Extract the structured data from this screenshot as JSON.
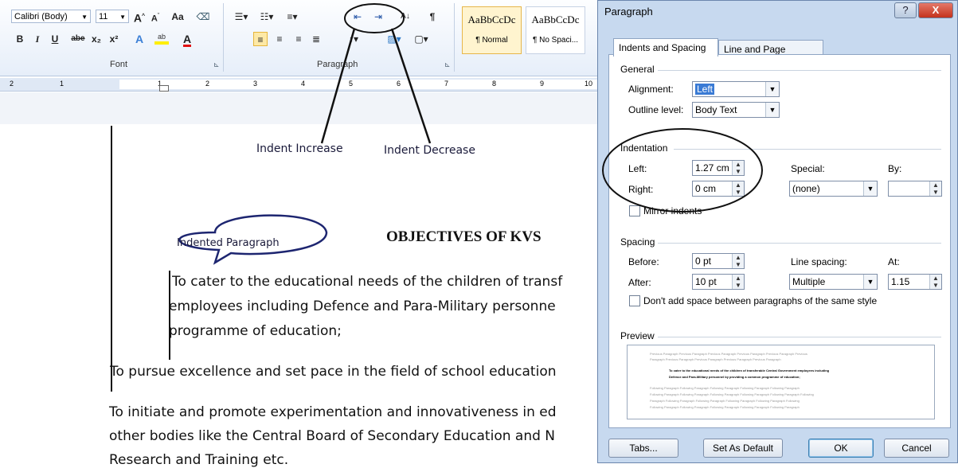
{
  "ribbon": {
    "font_name": "Calibri (Body)",
    "font_size": "11",
    "grow_font": "A",
    "shrink_font": "A",
    "change_case": "Aa",
    "bold": "B",
    "italic": "I",
    "underline": "U",
    "strike": "abe",
    "subscript": "x₂",
    "superscript": "x²",
    "font_color": "A",
    "font_group": "Font",
    "paragraph_group": "Paragraph",
    "styles": [
      {
        "preview": "AaBbCcDc",
        "name": "¶ Normal"
      },
      {
        "preview": "AaBbCcDc",
        "name": "¶ No Spaci..."
      }
    ]
  },
  "ruler": {
    "ticks": [
      "2",
      "1",
      "1",
      "2",
      "3",
      "4",
      "5",
      "6",
      "7",
      "8",
      "9",
      "10"
    ]
  },
  "annotations": {
    "indent_increase": "Indent Increase",
    "indent_decrease": "Indent Decrease",
    "bubble": "Indented Paragraph"
  },
  "document": {
    "heading": "OBJECTIVES OF KVS",
    "indented_lines": [
      "To cater to the educational needs of the children of transf",
      "employees including Defence  and Para-Military personne",
      "programme of education;"
    ],
    "para2": "To pursue excellence and set pace in the field of school education",
    "para3_lines": [
      "To initiate and promote experimentation and innovativeness in ed",
      "other bodies like the Central Board of Secondary Education and N",
      "Research and Training etc."
    ]
  },
  "dialog": {
    "title": "Paragraph",
    "help": "?",
    "close": "X",
    "tabs": [
      "Indents and Spacing",
      "Line and Page Breaks"
    ],
    "general": {
      "section": "General",
      "alignment_label": "Alignment:",
      "alignment_value": "Left",
      "outline_label": "Outline level:",
      "outline_value": "Body Text"
    },
    "indentation": {
      "section": "Indentation",
      "left_label": "Left:",
      "left_value": "1.27 cm",
      "right_label": "Right:",
      "right_value": "0 cm",
      "special_label": "Special:",
      "special_value": "(none)",
      "by_label": "By:",
      "by_value": "",
      "mirror_label": "Mirror indents"
    },
    "spacing": {
      "section": "Spacing",
      "before_label": "Before:",
      "before_value": "0 pt",
      "after_label": "After:",
      "after_value": "10 pt",
      "line_spacing_label": "Line spacing:",
      "line_spacing_value": "Multiple",
      "at_label": "At:",
      "at_value": "1.15",
      "dont_add_label": "Don't add space between paragraphs of the same style"
    },
    "preview": {
      "section": "Preview",
      "prev_lines": [
        "Previous Paragraph Previous Paragraph Previous Paragraph Previous Paragraph Previous Paragraph Previous",
        "Paragraph Previous Paragraph Previous Paragraph Previous Paragraph Previous Paragraph"
      ],
      "sample_lines": [
        "To cater to the educational needs of the children of transferable Central Government employees including",
        "Defence and Para-Military personnel by providing a common programme of education;"
      ],
      "follow_lines": [
        "Following Paragraph Following Paragraph Following Paragraph Following Paragraph Following Paragraph",
        "Following Paragraph Following Paragraph Following Paragraph Following Paragraph Following Paragraph Following",
        "Paragraph Following Paragraph Following Paragraph Following Paragraph Following Paragraph Following",
        "Following Paragraph Following Paragraph Following Paragraph Following Paragraph Following Paragraph"
      ]
    },
    "buttons": {
      "tabs": "Tabs...",
      "set_default": "Set As Default",
      "ok": "OK",
      "cancel": "Cancel"
    }
  }
}
